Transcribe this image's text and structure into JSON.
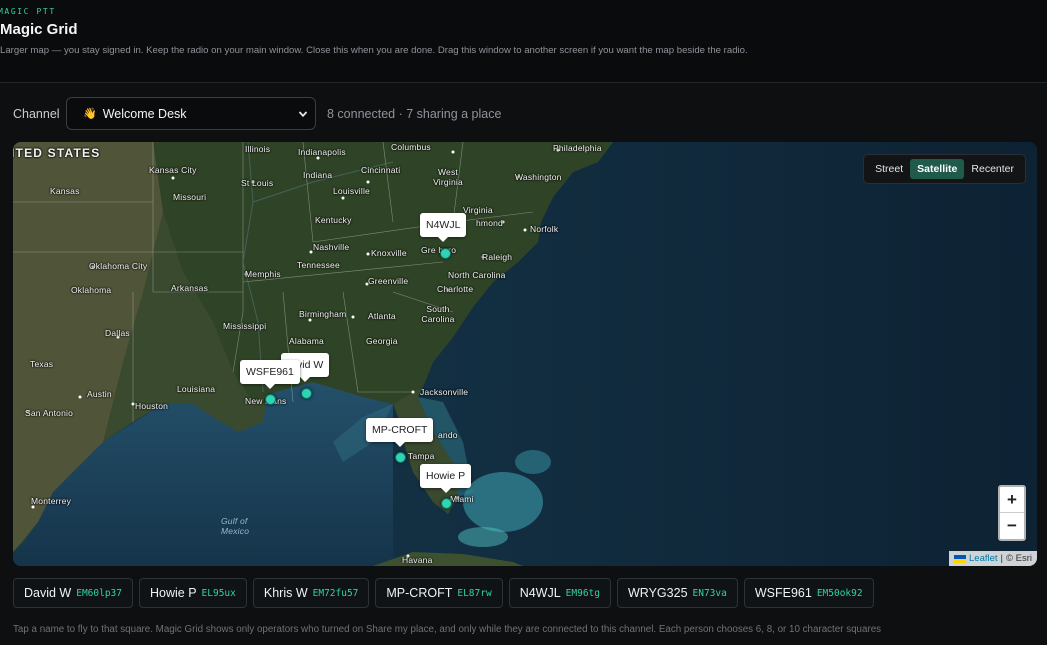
{
  "header": {
    "eyebrow": "MAGIC PTT",
    "title": "Magic Grid",
    "subtitle": "Larger map — you stay signed in. Keep the radio on your main window. Close this when you are done. Drag this window to another screen if you want the map beside the radio."
  },
  "channel": {
    "label": "Channel",
    "selected_icon": "👋",
    "selected": "Welcome Desk",
    "status": "8 connected · 7 sharing a place"
  },
  "map": {
    "controls": {
      "street": "Street",
      "satellite": "Satellite",
      "recenter": "Recenter",
      "active": "Satellite"
    },
    "zoom_in": "+",
    "zoom_out": "−",
    "attribution": {
      "leaflet": "Leaflet",
      "separator": "|",
      "esri": "© Esri"
    },
    "labels": {
      "united_states": "ITED STATES",
      "illinois": "Illinois",
      "indianapolis": "Indianapolis",
      "columbus": "Columbus",
      "philadelphia": "Philadelphia",
      "kansas_city": "Kansas City",
      "indiana": "Indiana",
      "cincinnati": "Cincinnati",
      "west_virginia": "West Virginia",
      "washington": "Washington",
      "kansas": "Kansas",
      "st_louis": "St Louis",
      "louisville": "Louisville",
      "missouri": "Missouri",
      "virginia": "Virginia",
      "richmond": "hmond",
      "kentucky": "Kentucky",
      "norfolk": "Norfolk",
      "nashville": "Nashville",
      "knoxville": "Knoxville",
      "greensboro": "Gre   boro",
      "raleigh": "Raleigh",
      "oklahoma_city": "Oklahoma City",
      "tennessee": "Tennessee",
      "memphis": "Memphis",
      "north_carolina": "North Carolina",
      "oklahoma": "Oklahoma",
      "arkansas": "Arkansas",
      "greenville": "Greenville",
      "charlotte": "Charlotte",
      "birmingham": "Birmingham",
      "atlanta": "Atlanta",
      "south_carolina": "South Carolina",
      "mississippi": "Mississippi",
      "dallas": "Dallas",
      "alabama": "Alabama",
      "georgia": "Georgia",
      "texas": "Texas",
      "louisiana": "Louisiana",
      "jacksonville": "Jacksonville",
      "austin": "Austin",
      "houston": "Houston",
      "new_orleans": "New   leans",
      "san_antonio": "San Antonio",
      "orlando": "ando",
      "tampa": "Tampa",
      "miami": "Miami",
      "monterrey": "Monterrey",
      "gulf_of_mexico": "Gulf of Mexico",
      "havana": "Havana"
    },
    "markers": {
      "n4wjl": "N4WJL",
      "david_w": "vid W",
      "wsfe961": "WSFE961",
      "mp_croft": "MP-CROFT",
      "howie_p": "Howie P"
    }
  },
  "operators": [
    {
      "name": "David W",
      "grid": "EM60lp37"
    },
    {
      "name": "Howie P",
      "grid": "EL95ux"
    },
    {
      "name": "Khris W",
      "grid": "EM72fu57"
    },
    {
      "name": "MP-CROFT",
      "grid": "EL87rw"
    },
    {
      "name": "N4WJL",
      "grid": "EM96tg"
    },
    {
      "name": "WRYG325",
      "grid": "EN73va"
    },
    {
      "name": "WSFE961",
      "grid": "EM50ok92"
    }
  ],
  "footnote": "Tap a name to fly to that square. Magic Grid shows only operators who turned on Share my place, and only while they are connected to this channel. Each person chooses 6, 8, or 10 character squares",
  "colors": {
    "accent": "#2fd3a6",
    "background": "#0a0b0c",
    "active_toggle": "#1f5a4b"
  }
}
